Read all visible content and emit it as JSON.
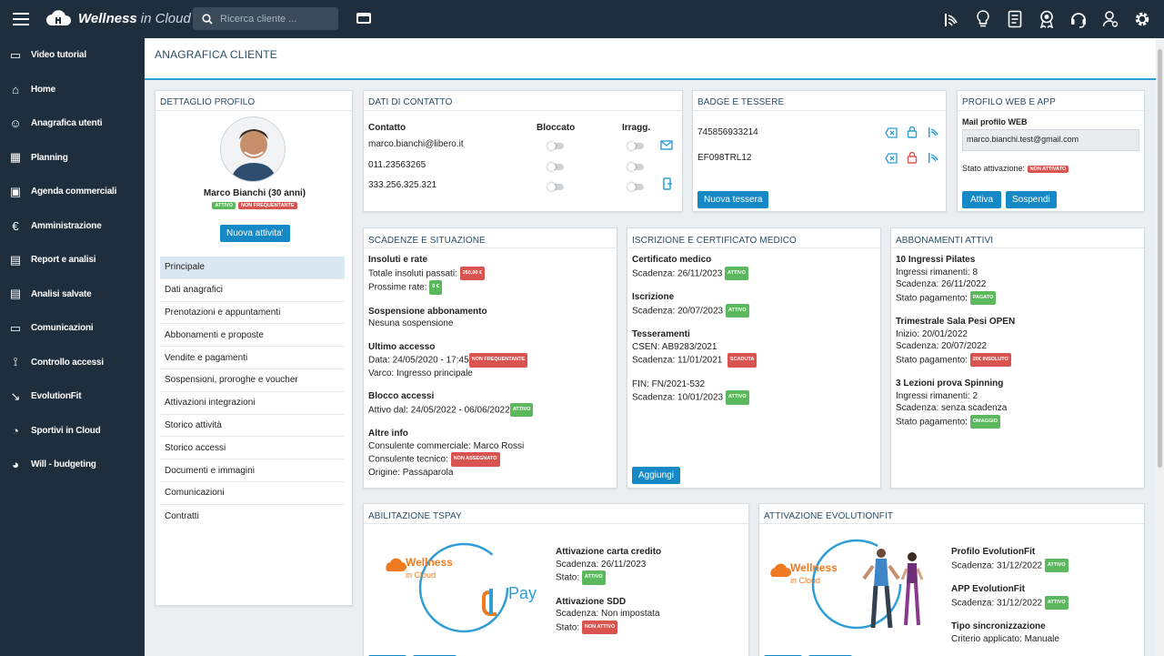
{
  "app": {
    "brand_bold": "Wellness",
    "brand_rest": "in Cloud",
    "search_placeholder": "Ricerca cliente ..."
  },
  "top_icons": [
    "access-control-icon",
    "lightbulb-icon",
    "document-icon",
    "award-icon",
    "headset-icon",
    "user-settings-icon",
    "gear-icon"
  ],
  "sidebar": {
    "items": [
      {
        "label": "Video tutorial",
        "icon": "video-icon"
      },
      {
        "label": "Home",
        "icon": "home-icon"
      },
      {
        "label": "Anagrafica utenti",
        "icon": "users-icon"
      },
      {
        "label": "Planning",
        "icon": "calendar-icon"
      },
      {
        "label": "Agenda commerciali",
        "icon": "agenda-icon"
      },
      {
        "label": "Amministrazione",
        "icon": "euro-icon"
      },
      {
        "label": "Report e analisi",
        "icon": "report-icon"
      },
      {
        "label": "Analisi salvate",
        "icon": "saved-report-icon"
      },
      {
        "label": "Comunicazioni",
        "icon": "chat-icon"
      },
      {
        "label": "Controllo accessi",
        "icon": "access-icon"
      },
      {
        "label": "EvolutionFit",
        "icon": "evolutionfit-icon"
      },
      {
        "label": "Sportivi in Cloud",
        "icon": "sport-icon"
      },
      {
        "label": "Will - budgeting",
        "icon": "pie-icon"
      }
    ]
  },
  "page": {
    "title": "ANAGRAFICA CLIENTE"
  },
  "profilo": {
    "title": "DETTAGLIO PROFILO",
    "name": "Marco Bianchi (30 anni)",
    "badge1": "ATTIVO",
    "badge2": "NON FREQUENTANTE",
    "new_activity": "Nuova attivita'",
    "menu": [
      "Principale",
      "Dati anagrafici",
      "Prenotazioni e appuntamenti",
      "Abbonamenti e proposte",
      "Vendite e pagamenti",
      "Sospensioni, proroghe e voucher",
      "Attivazioni integrazioni",
      "Storico attività",
      "Storico accessi",
      "Documenti e immagini",
      "Comunicazioni",
      "Contratti"
    ]
  },
  "contatti": {
    "title": "DATI DI CONTATTO",
    "col_contatto": "Contatto",
    "col_bloccato": "Bloccato",
    "col_irragg": "Irragg.",
    "rows": [
      "marco.bianchi@libero.it",
      "011.23563265",
      "333.256.325.321"
    ]
  },
  "badge": {
    "title": "BADGE E TESSERE",
    "rows": [
      "745856933214",
      "EF098TRL12"
    ],
    "new_btn": "Nuova tessera"
  },
  "web": {
    "title": "PROFILO WEB E APP",
    "mail_label": "Mail profilo WEB",
    "mail_value": "marco.bianchi.test@gmail.com",
    "stato_label": "Stato attivazione:",
    "stato_badge": "NON ATTIVATO",
    "btn_attiva": "Attiva",
    "btn_sospendi": "Sospendi"
  },
  "scadenze": {
    "title": "SCADENZE E SITUAZIONE",
    "insoluti_title": "Insoluti e rate",
    "insoluti_l1": "Totale insoluti passati:",
    "insoluti_b1": "250,00 €",
    "insoluti_l2": "Prossime rate:",
    "insoluti_b2": "0 €",
    "sosp_title": "Sospensione abbonamento",
    "sosp_l1": "Nesuna sospensione",
    "acc_title": "Ultimo accesso",
    "acc_l1": "Data: 24/05/2020 - 17:45",
    "acc_b1": "NON FREQUENTANTE",
    "acc_l2": "Varco: Ingresso principale",
    "blocco_title": "Blocco accessi",
    "blocco_l1": "Attivo dal: 24/05/2022 - 06/06/2022",
    "blocco_b1": "ATTIVO",
    "altre_title": "Altre info",
    "altre_l1": "Consulente commerciale: Marco Rossi",
    "altre_l2": "Consulente tecnico:",
    "altre_b2": "NON ASSEGNATO",
    "altre_l3": "Origine: Passaparola"
  },
  "iscrizione": {
    "title": "ISCRIZIONE E CERTIFICATO MEDICO",
    "cert_title": "Certificato medico",
    "cert_l1": "Scadenza: 26/11/2023",
    "cert_b1": "ATTIVO",
    "isc_title": "Iscrizione",
    "isc_l1": "Scadenza: 20/07/2023",
    "isc_b1": "ATTIVO",
    "tess_title": "Tesseramenti",
    "tess_l1": "CSEN: AB9283/2021",
    "tess_l2": "Scadenza: 11/01/2021",
    "tess_b2": "SCADUTA",
    "fin_l1": "FIN: FN/2021-532",
    "fin_l2": "Scadenza: 10/01/2023",
    "fin_b2": "ATTIVO",
    "btn": "Aggiungi"
  },
  "abbonamenti": {
    "title": "ABBONAMENTI ATTIVI",
    "a1_title": "10 Ingressi Pilates",
    "a1_l1": "Ingressi rimanenti: 8",
    "a1_l2": "Scadenza: 26/11/2022",
    "a1_l3": "Stato pagamento:",
    "a1_b3": "PAGATO",
    "a2_title": "Trimestrale Sala Pesi OPEN",
    "a2_l1": "Inizio: 20/01/2022",
    "a2_l2": "Scadenza: 20/07/2022",
    "a2_l3": "Stato pagamento:",
    "a2_b3": "20€ INSOLUTO",
    "a3_title": "3 Lezioni prova Spinning",
    "a3_l1": "Ingressi rimanenti: 2",
    "a3_l2": "Scadenza: senza scadenza",
    "a3_l3": "Stato pagamento:",
    "a3_b3": "OMAGGIO"
  },
  "tspay": {
    "title": "ABILITAZIONE TSPAY",
    "logo_w": "Wellness",
    "logo_c": "in Cloud",
    "pay": "Pay",
    "c_title": "Attivazione carta credito",
    "c_l1": "Scadenza: 26/11/2023",
    "c_l2": "Stato:",
    "c_b2": "ATTIVO",
    "s_title": "Attivazione SDD",
    "s_l1": "Scadenza: Non impostata",
    "s_l2": "Stato:",
    "s_b2": "NON ATTIVO"
  },
  "evo": {
    "title": "ATTIVAZIONE EVOLUTIONFIT",
    "logo_w": "Wellness",
    "logo_c": "in Cloud",
    "p_title": "Profilo EvolutionFit",
    "p_l1": "Scadenza: 31/12/2022",
    "p_b1": "ATTIVO",
    "a_title": "APP EvolutionFit",
    "a_l1": "Scadenza: 31/12/2022",
    "a_b1": "ATTIVO",
    "t_title": "Tipo sincronizzazione",
    "t_l1": "Criterio applicato: Manuale"
  }
}
